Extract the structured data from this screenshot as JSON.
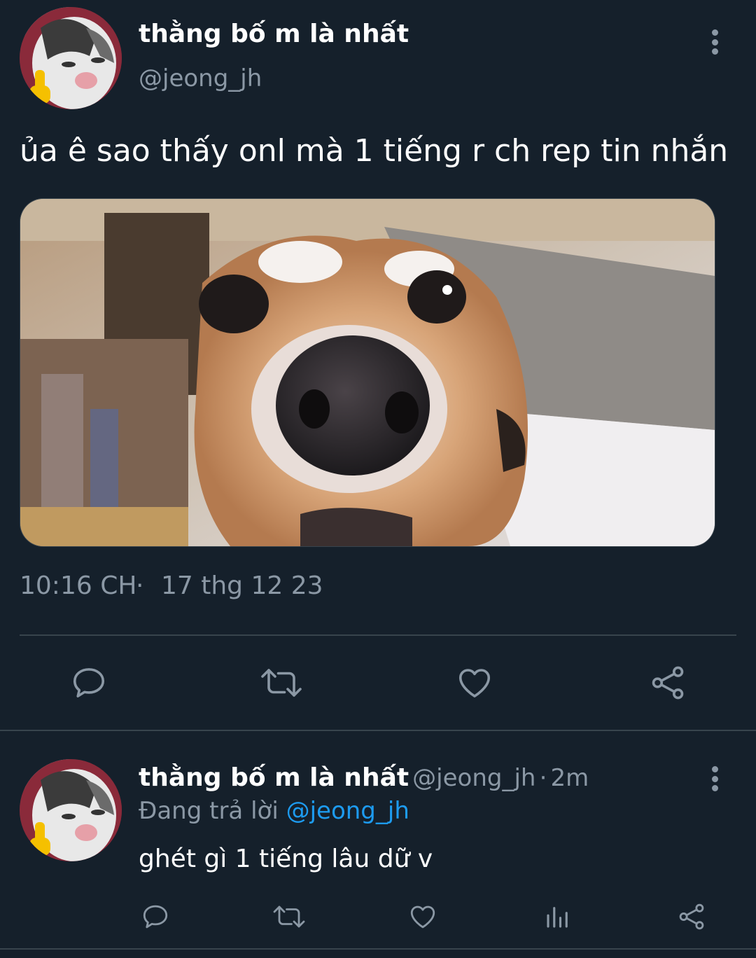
{
  "tweet": {
    "author": {
      "name": "thằng bố m là nhất",
      "handle": "@jeong_jh"
    },
    "text": "ủa ê sao thấy onl mà 1 tiếng r ch rep tin nhắn",
    "time": "10:16 CH",
    "separator": "·",
    "date": "17 thg 12 23",
    "actions": {
      "reply_icon": "comment-icon",
      "retweet_icon": "retweet-icon",
      "like_icon": "heart-icon",
      "share_icon": "share-icon"
    }
  },
  "reply": {
    "author": {
      "name": "thằng bố m là nhất",
      "handle": "@jeong_jh",
      "separator": "·",
      "age": "2m"
    },
    "replying_to_label": "Đang trả lời",
    "replying_to_handle": "@jeong_jh",
    "text": "ghét gì 1 tiếng lâu dữ v",
    "actions": {
      "reply_icon": "comment-icon",
      "retweet_icon": "retweet-icon",
      "like_icon": "heart-icon",
      "views_icon": "analytics-icon",
      "share_icon": "share-icon"
    }
  },
  "colors": {
    "background": "#15202b",
    "text": "#ffffff",
    "secondary": "#8b98a5",
    "accent": "#1d9bf0",
    "divider": "#38444d"
  }
}
